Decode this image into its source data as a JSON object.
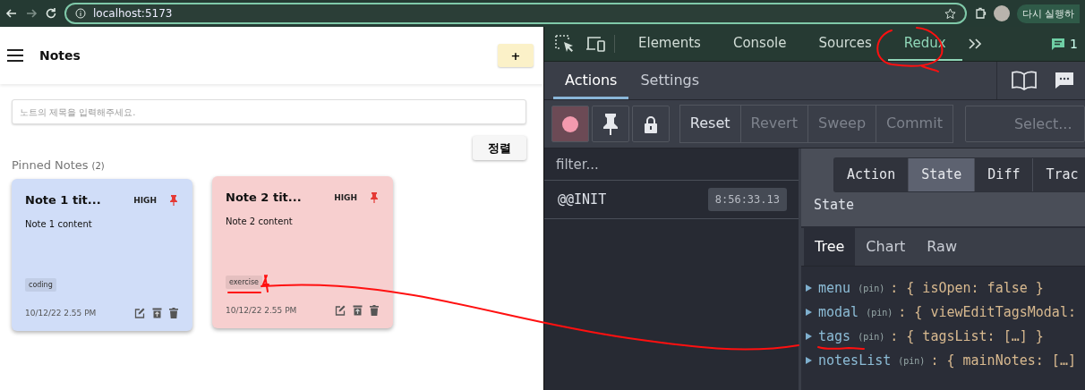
{
  "browser": {
    "url": "localhost:5173",
    "relaunch_button": "다시 실행하"
  },
  "app": {
    "title": "Notes",
    "add_button": "+",
    "search": {
      "placeholder": "노트의 제목을 입력해주세요."
    },
    "sort_button": "정렬",
    "section": {
      "title": "Pinned Notes",
      "count": "(2)"
    },
    "notes": [
      {
        "title": "Note 1 tit...",
        "priority": "HIGH",
        "content": "Note 1 content",
        "tags": [
          "coding"
        ],
        "date": "10/12/22 2.55 PM",
        "color": "#d0ddf8"
      },
      {
        "title": "Note 2 tit...",
        "priority": "HIGH",
        "content": "Note 2 content",
        "tags": [
          "exercise"
        ],
        "date": "10/12/22 2.55 PM",
        "color": "#f7cfcf"
      }
    ]
  },
  "devtools": {
    "tabs": [
      {
        "label": "Elements",
        "selected": false
      },
      {
        "label": "Console",
        "selected": false
      },
      {
        "label": "Sources",
        "selected": false
      },
      {
        "label": "Redux",
        "selected": true
      }
    ],
    "issues_count": "1",
    "redux": {
      "tabs": [
        {
          "label": "Actions",
          "selected": true
        },
        {
          "label": "Settings",
          "selected": false
        }
      ],
      "buttons": [
        {
          "label": "Reset",
          "disabled": false
        },
        {
          "label": "Revert",
          "disabled": true
        },
        {
          "label": "Sweep",
          "disabled": true
        },
        {
          "label": "Commit",
          "disabled": true
        }
      ],
      "select": {
        "placeholder": "Select..."
      },
      "filter": {
        "placeholder": "filter..."
      },
      "actions": [
        {
          "name": "@@INIT",
          "time": "8:56:33.13"
        }
      ],
      "monitor_tabs": [
        {
          "label": "Action",
          "selected": false
        },
        {
          "label": "State",
          "selected": true
        },
        {
          "label": "Diff",
          "selected": false
        },
        {
          "label": "Trac",
          "selected": false
        }
      ],
      "state_title": "State",
      "view_tabs": [
        {
          "label": "Tree",
          "selected": true
        },
        {
          "label": "Chart",
          "selected": false
        },
        {
          "label": "Raw",
          "selected": false
        }
      ],
      "tree": [
        {
          "key": "menu",
          "pin": "(pin)",
          "value": ": { isOpen: false }"
        },
        {
          "key": "modal",
          "pin": "(pin)",
          "value": ": { viewEditTagsModal:"
        },
        {
          "key": "tags",
          "pin": "(pin)",
          "value": ": { tagsList: […] }"
        },
        {
          "key": "notesList",
          "pin": "(pin)",
          "value": ": { mainNotes: […]"
        }
      ]
    }
  }
}
